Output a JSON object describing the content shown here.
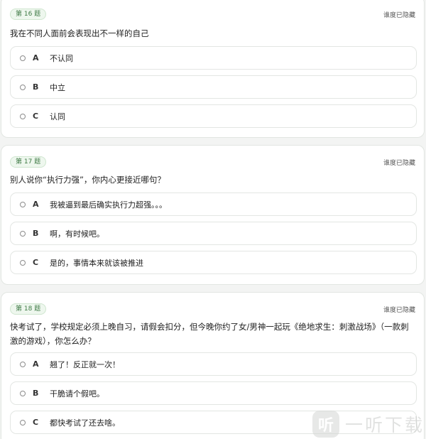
{
  "questions": [
    {
      "badge": "第 16 题",
      "hide_label": "谁度已隐藏",
      "text": "我在不同人面前会表现出不一样的自己",
      "options": [
        {
          "letter": "A",
          "text": "不认同"
        },
        {
          "letter": "B",
          "text": "中立"
        },
        {
          "letter": "C",
          "text": "认同"
        }
      ]
    },
    {
      "badge": "第 17 题",
      "hide_label": "谁度已隐藏",
      "text": "别人说你“执行力强”，你内心更接近哪句？",
      "options": [
        {
          "letter": "A",
          "text": "我被逼到最后确实执行力超强。。。"
        },
        {
          "letter": "B",
          "text": "啊，有时候吧。"
        },
        {
          "letter": "C",
          "text": "是的，事情本来就该被推进"
        }
      ]
    },
    {
      "badge": "第 18 题",
      "hide_label": "谁度已隐藏",
      "text": "快考试了，学校规定必须上晚自习，请假会扣分，但今晚你约了女/男神一起玩《绝地求生：刺激战场》（一款刺激的游戏），你怎么办？",
      "options": [
        {
          "letter": "A",
          "text": "翘了！反正就一次！"
        },
        {
          "letter": "B",
          "text": "干脆请个假吧。"
        },
        {
          "letter": "C",
          "text": "都快考试了还去啥。"
        }
      ]
    }
  ],
  "watermark": {
    "logo_char": "听",
    "text": "一听下载"
  },
  "colors": {
    "badge_bg": "#eef7ee",
    "badge_text": "#3f7a45",
    "card_border": "#e2e6e2",
    "page_bg": "#f3f4f3"
  },
  "icons": {
    "radio": "radio-unselected-icon"
  }
}
